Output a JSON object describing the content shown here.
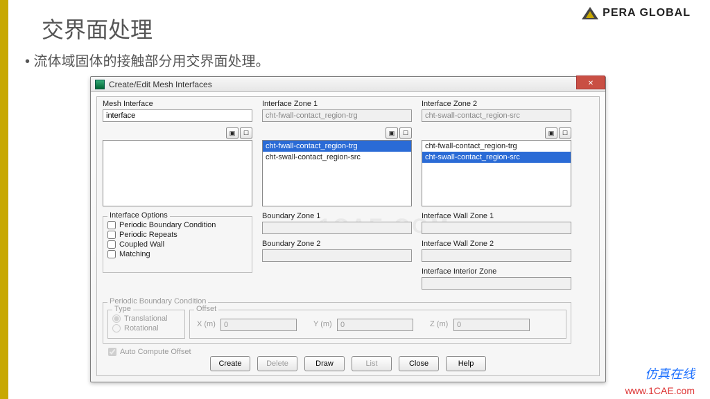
{
  "slide": {
    "title": "交界面处理",
    "bullet": "• 流体域固体的接触部分用交界面处理。",
    "logo_text": "PERA GLOBAL",
    "footer_cn": "仿真在线",
    "footer_url": "www.1CAE.com",
    "watermark": "1CAE.COM"
  },
  "dialog": {
    "title": "Create/Edit Mesh Interfaces",
    "labels": {
      "mesh_interface": "Mesh Interface",
      "zone1": "Interface Zone 1",
      "zone2": "Interface Zone 2",
      "options": "Interface Options",
      "bz1": "Boundary Zone 1",
      "bz2": "Boundary Zone 2",
      "iwz1": "Interface Wall Zone 1",
      "iwz2": "Interface Wall Zone 2",
      "iiz": "Interface Interior Zone",
      "pbc": "Periodic Boundary Condition",
      "type": "Type",
      "offset": "Offset",
      "x": "X (m)",
      "y": "Y (m)",
      "z": "Z (m)"
    },
    "values": {
      "mesh_interface": "interface",
      "zone1": "cht-fwall-contact_region-trg",
      "zone2": "cht-swall-contact_region-src",
      "offset_x": "0",
      "offset_y": "0",
      "offset_z": "0"
    },
    "zone1_list": {
      "item0": "cht-fwall-contact_region-trg",
      "item1": "cht-swall-contact_region-src"
    },
    "zone2_list": {
      "item0": "cht-fwall-contact_region-trg",
      "item1": "cht-swall-contact_region-src"
    },
    "options": {
      "pbc": "Periodic Boundary Condition",
      "pr": "Periodic Repeats",
      "cw": "Coupled Wall",
      "mt": "Matching",
      "trans": "Translational",
      "rot": "Rotational",
      "autoco": "Auto Compute Offset"
    },
    "buttons": {
      "create": "Create",
      "delete": "Delete",
      "draw": "Draw",
      "list": "List",
      "close": "Close",
      "help": "Help"
    }
  }
}
